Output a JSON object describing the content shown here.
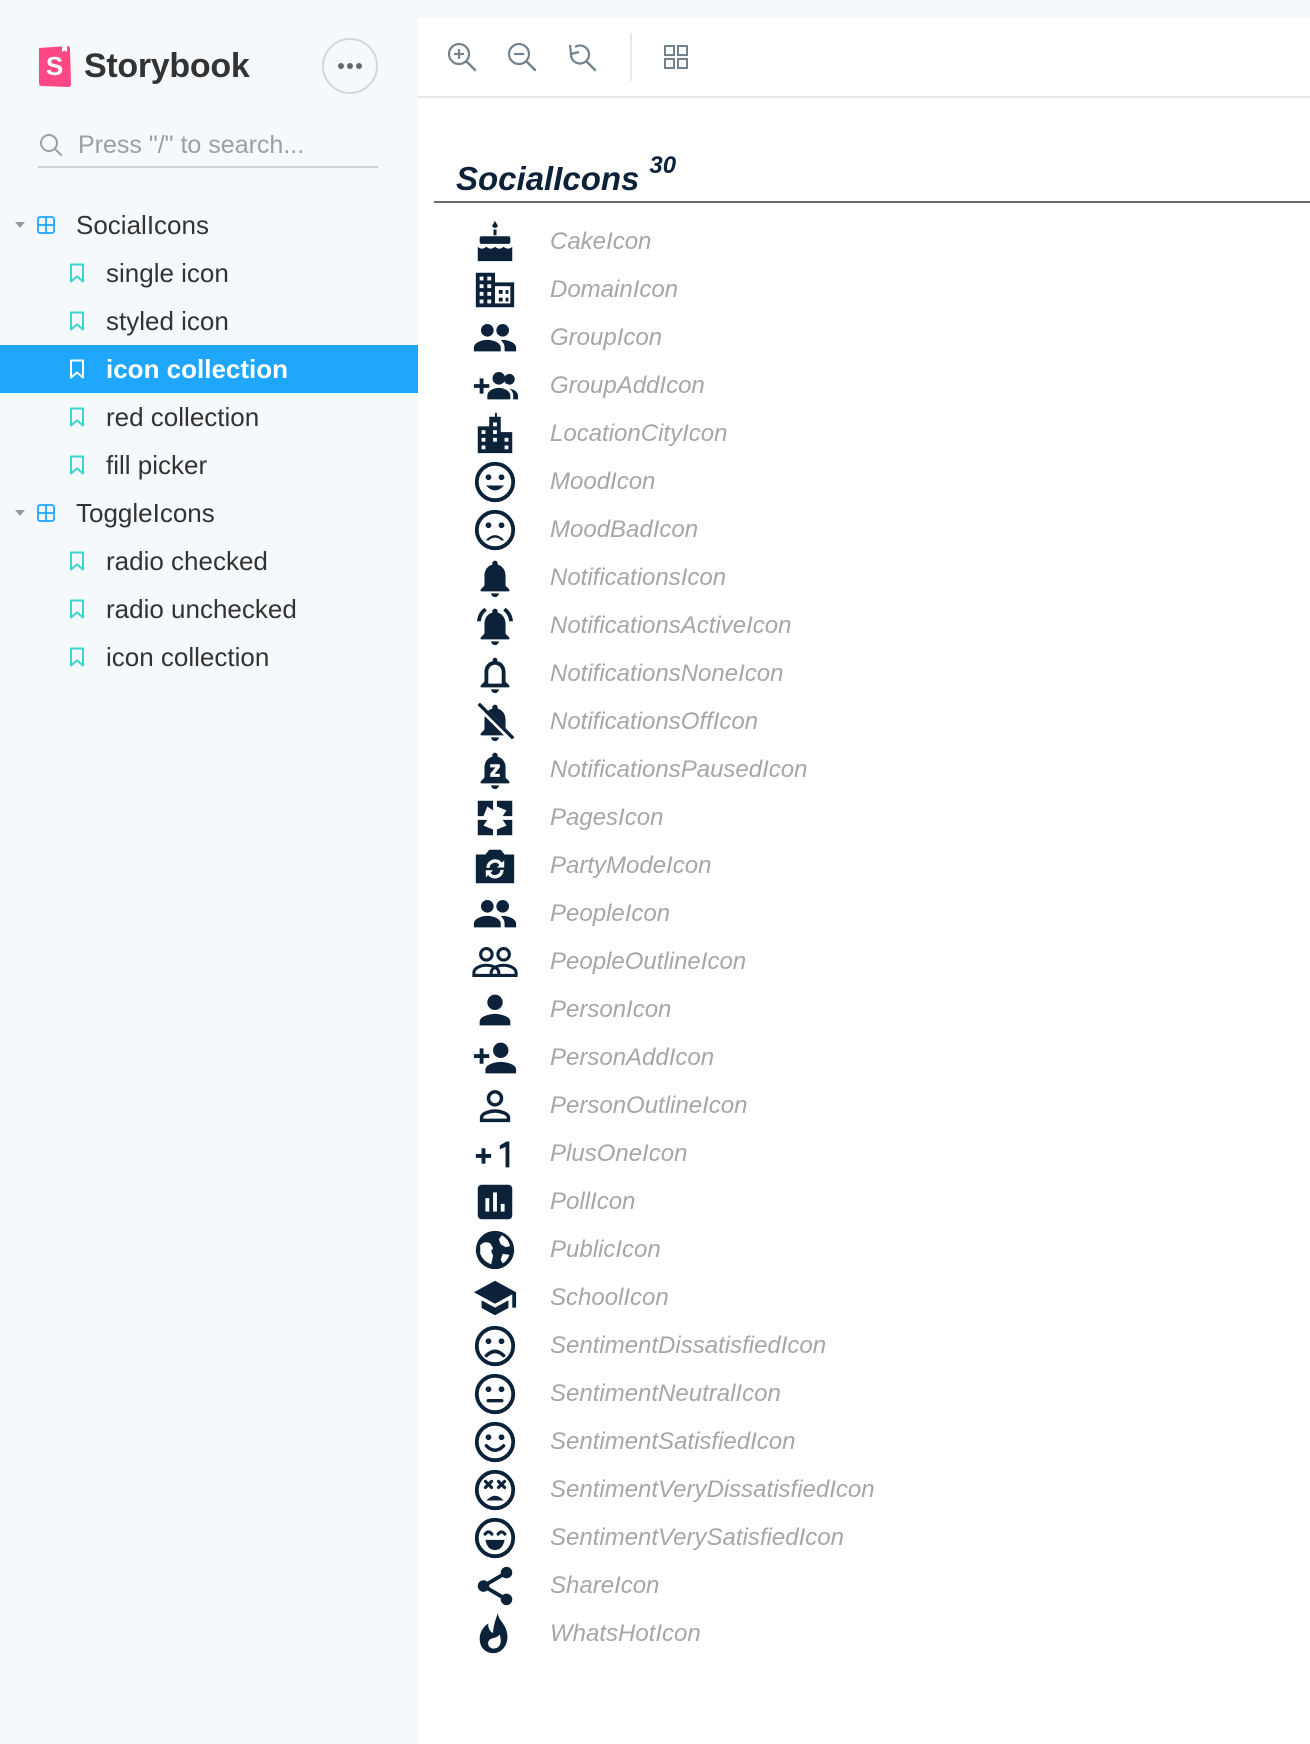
{
  "app": {
    "name": "Storybook",
    "brand_color": "#ff4785",
    "accent_color": "#1ea7fd"
  },
  "search": {
    "placeholder": "Press \"/\" to search..."
  },
  "sidebar": {
    "groups": [
      {
        "label": "SocialIcons",
        "stories": [
          "single icon",
          "styled icon",
          "icon collection",
          "red collection",
          "fill picker"
        ],
        "active_story": "icon collection"
      },
      {
        "label": "ToggleIcons",
        "stories": [
          "radio checked",
          "radio unchecked",
          "icon collection"
        ]
      }
    ]
  },
  "toolbar": {
    "tools": [
      "zoom-in-icon",
      "zoom-out-icon",
      "zoom-reset-icon",
      "grid-icon"
    ]
  },
  "main": {
    "title": "SocialIcons",
    "count": "30",
    "icon_color": "#0b2239",
    "label_color": "#a6a6a6",
    "icons": [
      {
        "label": "CakeIcon",
        "icon": "cake-icon"
      },
      {
        "label": "DomainIcon",
        "icon": "domain-icon"
      },
      {
        "label": "GroupIcon",
        "icon": "group-icon"
      },
      {
        "label": "GroupAddIcon",
        "icon": "group-add-icon"
      },
      {
        "label": "LocationCityIcon",
        "icon": "location-city-icon"
      },
      {
        "label": "MoodIcon",
        "icon": "mood-icon"
      },
      {
        "label": "MoodBadIcon",
        "icon": "mood-bad-icon"
      },
      {
        "label": "NotificationsIcon",
        "icon": "notifications-icon"
      },
      {
        "label": "NotificationsActiveIcon",
        "icon": "notifications-active-icon"
      },
      {
        "label": "NotificationsNoneIcon",
        "icon": "notifications-none-icon"
      },
      {
        "label": "NotificationsOffIcon",
        "icon": "notifications-off-icon"
      },
      {
        "label": "NotificationsPausedIcon",
        "icon": "notifications-paused-icon"
      },
      {
        "label": "PagesIcon",
        "icon": "pages-icon"
      },
      {
        "label": "PartyModeIcon",
        "icon": "party-mode-icon"
      },
      {
        "label": "PeopleIcon",
        "icon": "people-icon"
      },
      {
        "label": "PeopleOutlineIcon",
        "icon": "people-outline-icon"
      },
      {
        "label": "PersonIcon",
        "icon": "person-icon"
      },
      {
        "label": "PersonAddIcon",
        "icon": "person-add-icon"
      },
      {
        "label": "PersonOutlineIcon",
        "icon": "person-outline-icon"
      },
      {
        "label": "PlusOneIcon",
        "icon": "plus-one-icon"
      },
      {
        "label": "PollIcon",
        "icon": "poll-icon"
      },
      {
        "label": "PublicIcon",
        "icon": "public-icon"
      },
      {
        "label": "SchoolIcon",
        "icon": "school-icon"
      },
      {
        "label": "SentimentDissatisfiedIcon",
        "icon": "sentiment-dissatisfied-icon"
      },
      {
        "label": "SentimentNeutralIcon",
        "icon": "sentiment-neutral-icon"
      },
      {
        "label": "SentimentSatisfiedIcon",
        "icon": "sentiment-satisfied-icon"
      },
      {
        "label": "SentimentVeryDissatisfiedIcon",
        "icon": "sentiment-very-dissatisfied-icon"
      },
      {
        "label": "SentimentVerySatisfiedIcon",
        "icon": "sentiment-very-satisfied-icon"
      },
      {
        "label": "ShareIcon",
        "icon": "share-icon"
      },
      {
        "label": "WhatsHotIcon",
        "icon": "whats-hot-icon"
      }
    ]
  }
}
